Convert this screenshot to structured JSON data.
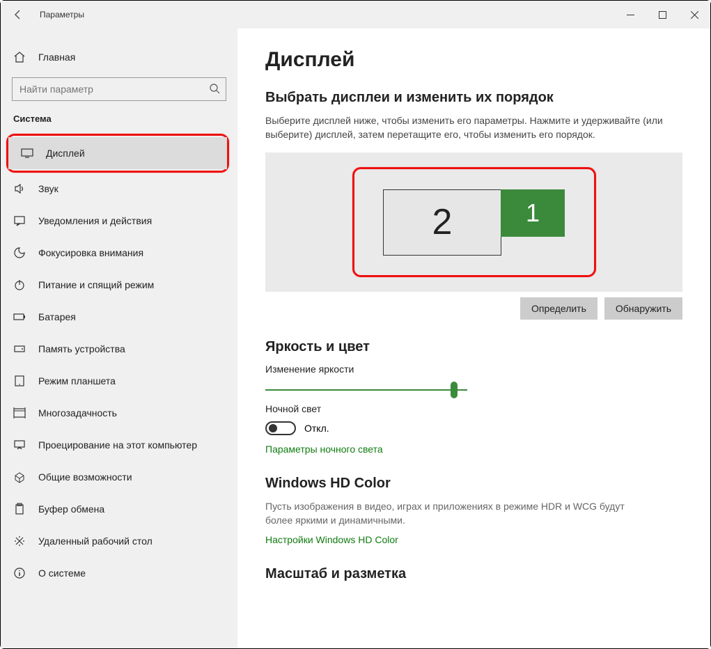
{
  "window": {
    "title": "Параметры"
  },
  "sidebar": {
    "home": "Главная",
    "search_placeholder": "Найти параметр",
    "group": "Система",
    "items": [
      {
        "label": "Дисплей",
        "icon": "display-icon"
      },
      {
        "label": "Звук",
        "icon": "sound-icon"
      },
      {
        "label": "Уведомления и действия",
        "icon": "notifications-icon"
      },
      {
        "label": "Фокусировка внимания",
        "icon": "focus-icon"
      },
      {
        "label": "Питание и спящий режим",
        "icon": "power-icon"
      },
      {
        "label": "Батарея",
        "icon": "battery-icon"
      },
      {
        "label": "Память устройства",
        "icon": "storage-icon"
      },
      {
        "label": "Режим планшета",
        "icon": "tablet-icon"
      },
      {
        "label": "Многозадачность",
        "icon": "multitask-icon"
      },
      {
        "label": "Проецирование на этот компьютер",
        "icon": "projecting-icon"
      },
      {
        "label": "Общие возможности",
        "icon": "shared-icon"
      },
      {
        "label": "Буфер обмена",
        "icon": "clipboard-icon"
      },
      {
        "label": "Удаленный рабочий стол",
        "icon": "remote-icon"
      },
      {
        "label": "О системе",
        "icon": "about-icon"
      }
    ]
  },
  "main": {
    "title": "Дисплей",
    "arrange_heading": "Выбрать дисплеи и изменить их порядок",
    "arrange_desc": "Выберите дисплей ниже, чтобы изменить его параметры. Нажмите и удерживайте (или выберите) дисплей, затем перетащите его, чтобы изменить его порядок.",
    "monitor2": "2",
    "monitor1": "1",
    "identify_btn": "Определить",
    "detect_btn": "Обнаружить",
    "brightness_heading": "Яркость и цвет",
    "brightness_label": "Изменение яркости",
    "brightness_value": 95,
    "night_light_label": "Ночной свет",
    "night_light_state": "Откл.",
    "night_light_link": "Параметры ночного света",
    "hd_heading": "Windows HD Color",
    "hd_desc": "Пусть изображения в видео, играх и приложениях в режиме HDR и WCG будут более яркими и динамичными.",
    "hd_link": "Настройки Windows HD Color",
    "scale_heading": "Масштаб и разметка"
  }
}
